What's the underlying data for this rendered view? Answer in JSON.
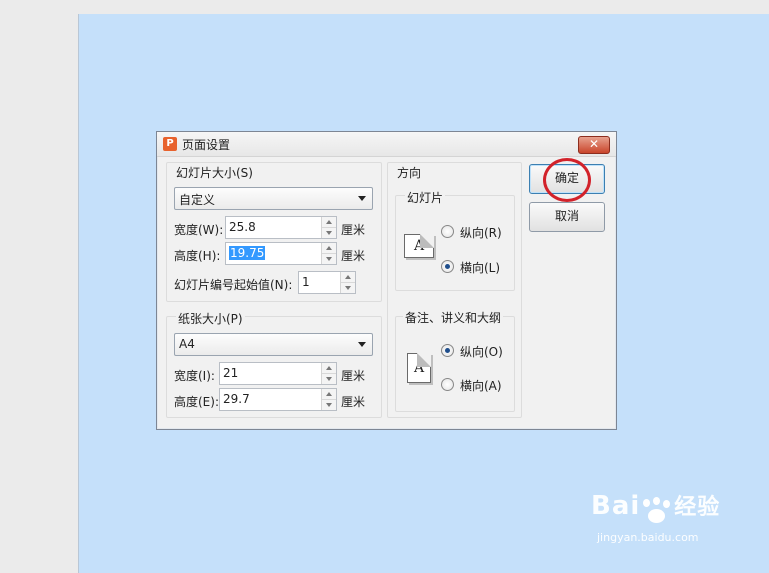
{
  "dialog": {
    "title": "页面设置",
    "app_icon": "P",
    "close_icon": "✕",
    "slide_size": {
      "group_label": "幻灯片大小(S)",
      "preset": "自定义",
      "width_label": "宽度(W):",
      "width_value": "25.8",
      "height_label": "高度(H):",
      "height_value": "19.75",
      "unit": "厘米",
      "start_number_label": "幻灯片编号起始值(N):",
      "start_number_value": "1"
    },
    "paper_size": {
      "group_label": "纸张大小(P)",
      "preset": "A4",
      "width_label": "宽度(I):",
      "width_value": "21",
      "height_label": "高度(E):",
      "height_value": "29.7",
      "unit": "厘米"
    },
    "orientation": {
      "group_label": "方向",
      "slides_label": "幻灯片",
      "slides_options": [
        {
          "label": "纵向(R)",
          "selected": false
        },
        {
          "label": "横向(L)",
          "selected": true
        }
      ],
      "notes_label": "备注、讲义和大纲",
      "notes_options": [
        {
          "label": "纵向(O)",
          "selected": true
        },
        {
          "label": "横向(A)",
          "selected": false
        }
      ],
      "page_icon_letter": "A"
    },
    "ok_label": "确定",
    "cancel_label": "取消"
  },
  "watermark": {
    "logo_left": "Bai",
    "logo_right": "经验",
    "url": "jingyan.baidu.com"
  },
  "colors": {
    "slide_background": "#c5e0fa",
    "highlight_ring": "#d2222a",
    "selection": "#3399ff"
  }
}
